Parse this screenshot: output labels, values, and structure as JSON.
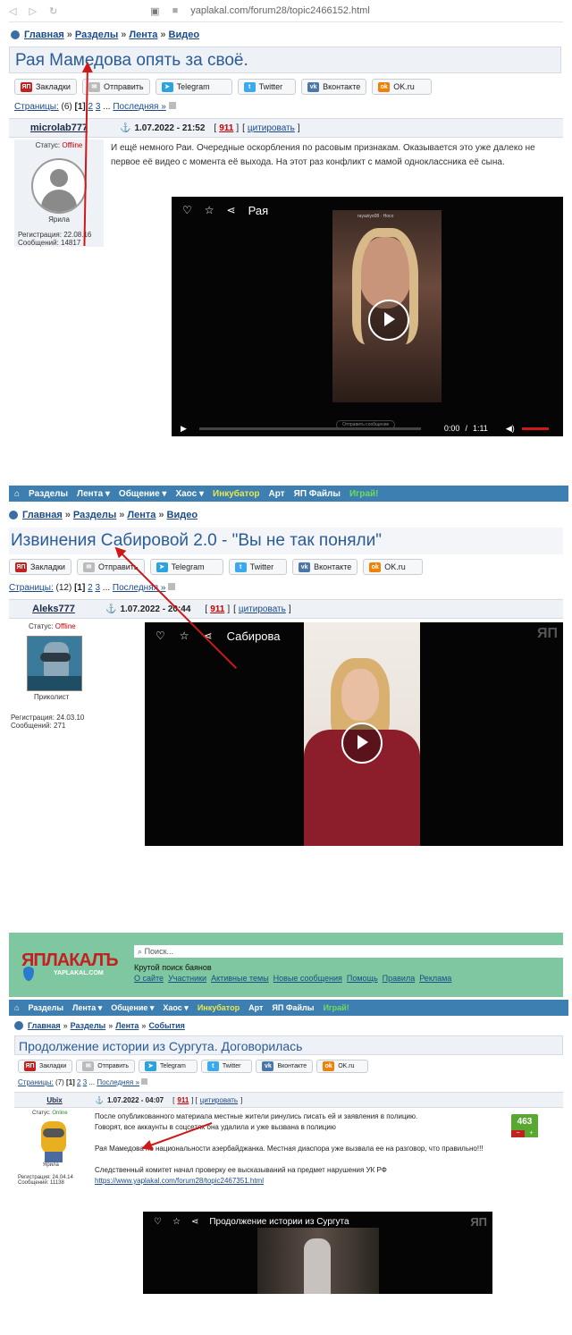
{
  "colors": {
    "link": "#1a4a8a",
    "title": "#2a5c97",
    "accent": "#d01818",
    "nav": "#3d7fb0",
    "header_green": "#7fc7a1"
  },
  "browser": {
    "url": "yaplakal.com/forum28/topic2466152.html"
  },
  "breadcrumb": {
    "home": "Главная",
    "sections": "Разделы",
    "feed": "Лента",
    "video": "Видео",
    "events": "События",
    "separator": "»"
  },
  "share": {
    "bookmarks": "Закладки",
    "send": "Отправить",
    "telegram": "Telegram",
    "twitter": "Twitter",
    "vk": "Вконтакте",
    "ok": "OK.ru"
  },
  "labels": {
    "pages": "Страницы:",
    "last": "Последняя »",
    "status": "Статус:",
    "reg": "Регистрация:",
    "msgs": "Сообщений:",
    "cite": "цитировать",
    "ellipsis": "..."
  },
  "nav": {
    "sections": "Разделы",
    "feed": "Лента ▾",
    "social": "Общение ▾",
    "chaos": "Хаос ▾",
    "incubator": "Инкубатор",
    "art": "Арт",
    "files": "ЯП Файлы",
    "play": "Играй!"
  },
  "post1": {
    "title": "Рая Мамедова опять за своё.",
    "pages_count": "(6)",
    "page1": "[1]",
    "page2": "2",
    "page3": "3",
    "author": "microlab777",
    "status": "Offline",
    "rank": "Ярила",
    "reg_date": "22.08.16",
    "msg_count": "14817",
    "date": "1.07.2022 - 21:52",
    "rating": "911",
    "text": "И ещё немного Раи. Очередные оскорбления по расовым признакам. Оказывается это уже далеко не первое её видео с момента её выхода. На этот раз конфликт с мамой одноклассника её сына.",
    "video_title": "Рая",
    "time_current": "0:00",
    "time_sep": "/",
    "time_total": "1:11",
    "phone_caption": "Отправить сообщение",
    "phone_user": "rayaziyo08 · Носо"
  },
  "post2": {
    "title": "Извинения Сабировой 2.0 - \"Вы не так поняли\"",
    "pages_count": "(12)",
    "page1": "[1]",
    "page2": "2",
    "page3": "3",
    "author": "Aleks777",
    "status": "Offline",
    "rank": "Приколист",
    "reg_date": "24.03.10",
    "msg_count": "271",
    "date": "1.07.2022 - 20:44",
    "rating": "911",
    "video_title": "Сабирова",
    "watermark": "ЯП"
  },
  "post3": {
    "logo": "ЯПЛАКАЛЪ",
    "logo_sub": "YAPLAKAL.COM",
    "search_placeholder": "Поиск...",
    "search_hint": "Крутой поиск баянов",
    "top_links": [
      "О сайте",
      "Участники",
      "Активные темы",
      "Новые сообщения",
      "Помощь",
      "Правила",
      "Реклама"
    ],
    "title": "Продолжение истории из Сургута. Договорилась",
    "pages_count": "(7)",
    "page1": "[1]",
    "page2": "2",
    "page3": "3",
    "author": "Ubix",
    "status": "Online",
    "rank": "Ярила",
    "reg_date": "24.04.14",
    "msg_count": "11138",
    "date": "1.07.2022 - 04:07",
    "rating": "911",
    "para1": "После опубликованного материала местные жители ринулись писать ей и заявления в полицию.",
    "para2": "Говорят, все аккаунты в соцсетях она удалила и уже вызвана в полицию",
    "para3": "Рая Мамедова по национальности азербайджанка. Местная диаспора уже вызвала ее на разговор, что правильно!!!",
    "para4": "Следственный комитет начал проверку ее высказываний на предмет нарушения УК РФ",
    "link": "https://www.yaplakal.com/forum28/topic2467351.html",
    "video_title": "Продолжение истории из Сургута",
    "score": "463",
    "minus": "−",
    "plus": "+",
    "watermark": "ЯП"
  }
}
